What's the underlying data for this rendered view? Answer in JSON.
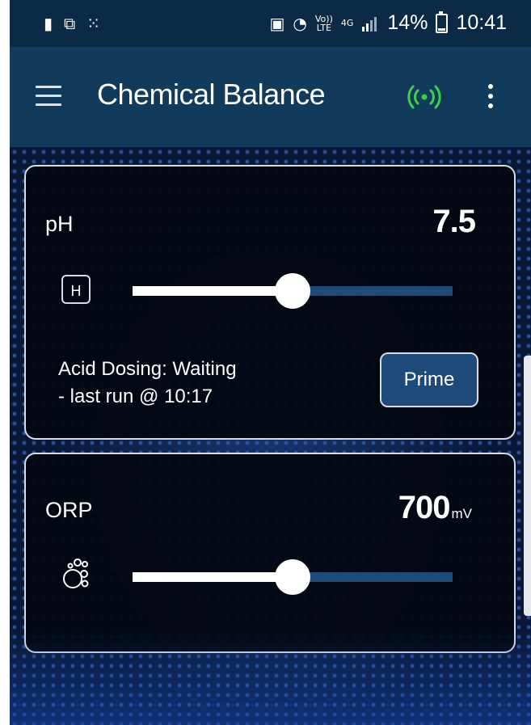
{
  "status_bar": {
    "left_icons": [
      "battery-alert-icon",
      "screen-cast-icon",
      "dots-icon"
    ],
    "volte_top": "Vo))",
    "volte_bottom": "LTE",
    "network_type": "4G",
    "battery_percent": "14%",
    "time": "10:41"
  },
  "app_bar": {
    "title": "Chemical Balance",
    "connection_color": "#3ecf4c"
  },
  "ph_card": {
    "label": "pH",
    "value": "7.5",
    "badge": "H",
    "slider_fraction": 0.5,
    "dosing_line1": "Acid Dosing: Waiting",
    "dosing_line2": "- last run @ 10:17",
    "prime_label": "Prime"
  },
  "orp_card": {
    "label": "ORP",
    "value": "700",
    "unit": "mV",
    "slider_fraction": 0.5
  }
}
